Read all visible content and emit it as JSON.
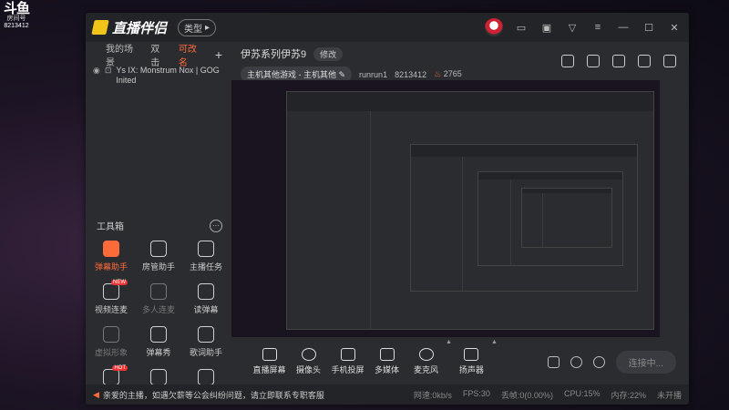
{
  "watermark": {
    "logo": "斗鱼",
    "sub": "房间号",
    "room": "8213412"
  },
  "app": {
    "brand": "直播伴侣",
    "type_label": "类型"
  },
  "sidebar": {
    "tabs": [
      {
        "label": "我的场景"
      },
      {
        "label": "双击"
      },
      {
        "label": "可改名"
      }
    ],
    "add_label": "+",
    "source": {
      "name": "Ys IX: Monstrum Nox | GOG Inited"
    },
    "tools_title": "工具箱",
    "tools": [
      {
        "label": "弹幕助手"
      },
      {
        "label": "房管助手"
      },
      {
        "label": "主播任务"
      },
      {
        "label": "视频连麦",
        "badge": "NEW"
      },
      {
        "label": "多人连麦"
      },
      {
        "label": "读弹幕"
      },
      {
        "label": "虚拟形象"
      },
      {
        "label": "弹幕秀"
      },
      {
        "label": "歌词助手"
      },
      {
        "label": "",
        "badge": "HOT"
      },
      {
        "label": ""
      },
      {
        "label": ""
      }
    ]
  },
  "room": {
    "title": "伊苏系列伊苏9",
    "edit_label": "修改",
    "category": "主机其他游戏 - 主机其他",
    "user": "runrun1",
    "room_id": "8213412",
    "heat": "2765"
  },
  "controls": [
    {
      "label": "直播屏幕"
    },
    {
      "label": "摄像头"
    },
    {
      "label": "手机投屏"
    },
    {
      "label": "多媒体"
    },
    {
      "label": "麦克风"
    },
    {
      "label": "扬声器"
    }
  ],
  "connect_label": "连接中...",
  "status": {
    "notice": "亲爱的主播，如遇欠薪等公会纠纷问题，请立即联系专职客服",
    "net": "网速:0kb/s",
    "fps": "FPS:30",
    "drop": "丢帧:0(0.00%)",
    "cpu": "CPU:15%",
    "mem": "内存:22%",
    "live": "未开播"
  }
}
